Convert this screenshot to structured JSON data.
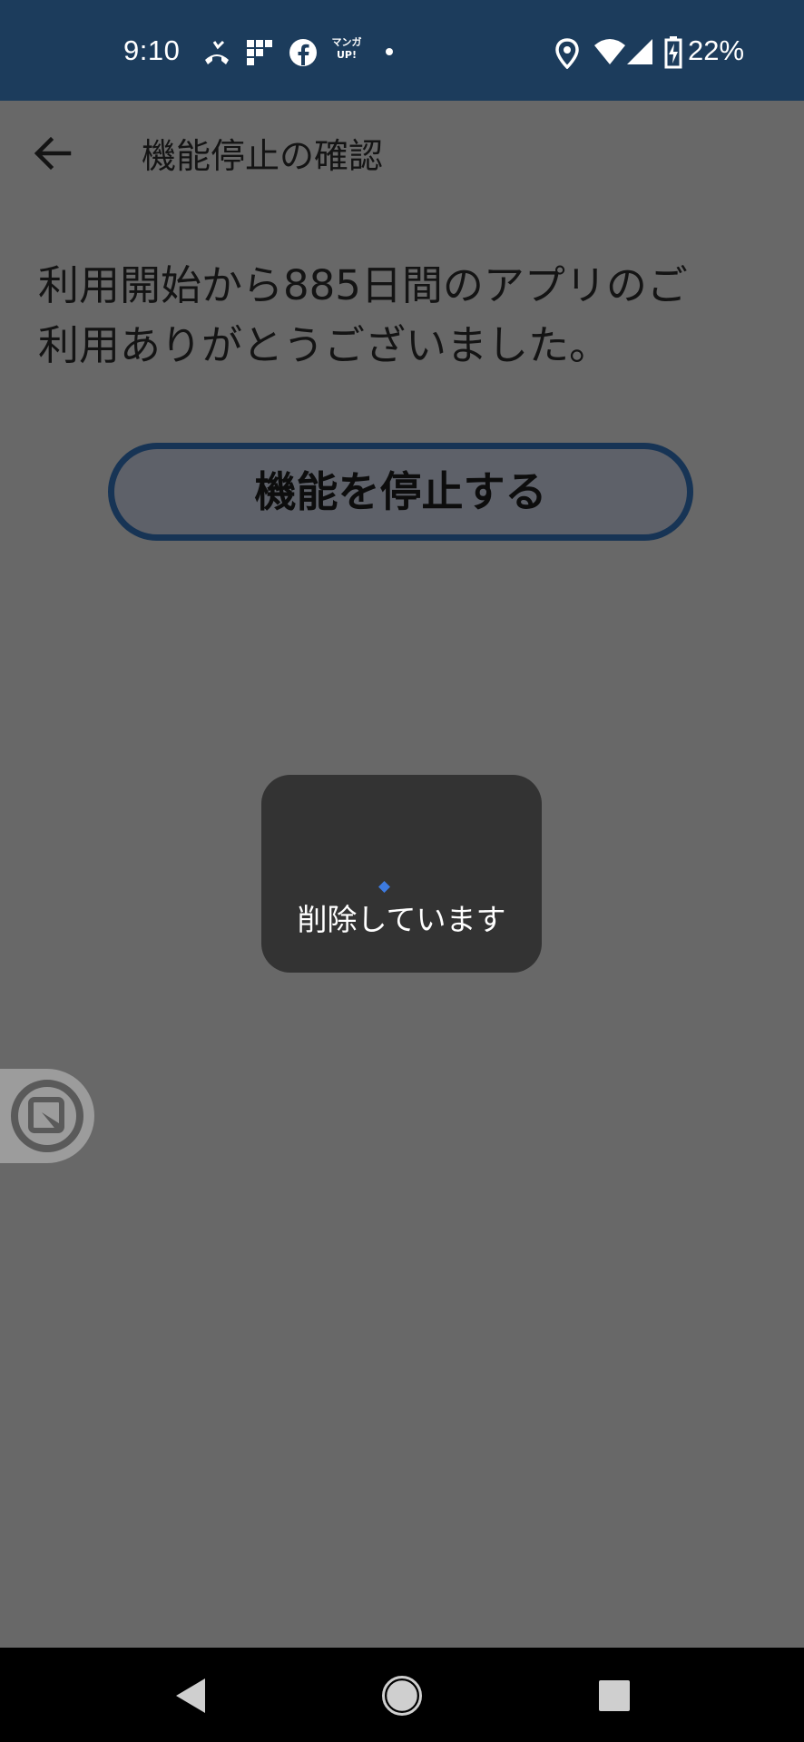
{
  "status_bar": {
    "time": "9:10",
    "battery_percent": "22%",
    "icons": [
      "missed-call-icon",
      "app-grid-icon",
      "facebook-icon",
      "manga-up-icon",
      "dot-icon",
      "location-icon",
      "wifi-icon",
      "signal-icon",
      "battery-charging-icon"
    ],
    "manga_icon_text": "マンガ UP!"
  },
  "app_bar": {
    "title": "機能停止の確認",
    "back_icon": "arrow-back-icon"
  },
  "main": {
    "message_line1": "利用開始から885日間のアプリのご",
    "message_line2": "利用ありがとうございました。",
    "stop_button_label": "機能を停止する"
  },
  "progress_dialog": {
    "text": "削除しています",
    "spinner_color": "#3d7be0"
  },
  "nav_bar": {
    "icons": [
      "back-triangle-icon",
      "home-circle-icon",
      "recents-square-icon"
    ]
  },
  "colors": {
    "status_bar_bg": "#1c3c5c",
    "scrim_bg": "#686868",
    "button_border": "#173455",
    "dialog_bg": "#333333"
  }
}
